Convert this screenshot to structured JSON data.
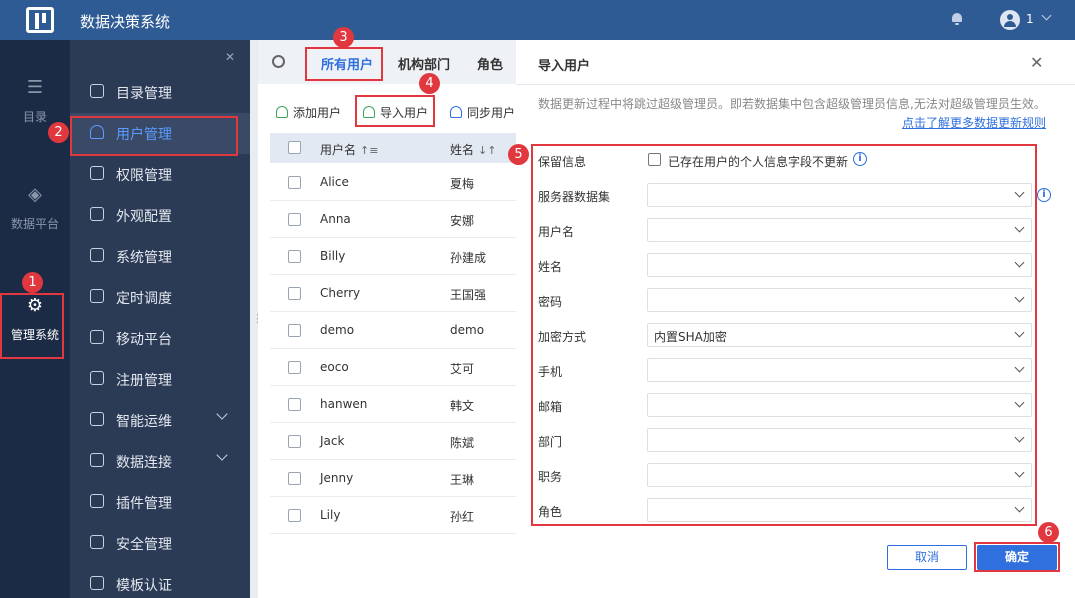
{
  "app": {
    "title": "数据决策系统",
    "user": "1"
  },
  "rail": [
    {
      "label": "目录",
      "icon": "list-icon"
    },
    {
      "label": "数据平台",
      "icon": "cube-icon"
    },
    {
      "label": "管理系统",
      "icon": "gear-icon"
    }
  ],
  "menu": [
    {
      "label": "目录管理",
      "icon": "catalog-icon"
    },
    {
      "label": "用户管理",
      "icon": "user-icon"
    },
    {
      "label": "权限管理",
      "icon": "lock-icon"
    },
    {
      "label": "外观配置",
      "icon": "brush-icon"
    },
    {
      "label": "系统管理",
      "icon": "settings-icon"
    },
    {
      "label": "定时调度",
      "icon": "clock-icon"
    },
    {
      "label": "移动平台",
      "icon": "mobile-icon"
    },
    {
      "label": "注册管理",
      "icon": "register-icon"
    },
    {
      "label": "智能运维",
      "icon": "ops-icon"
    },
    {
      "label": "数据连接",
      "icon": "link-icon"
    },
    {
      "label": "插件管理",
      "icon": "plugin-icon"
    },
    {
      "label": "安全管理",
      "icon": "shield-icon"
    },
    {
      "label": "模板认证",
      "icon": "template-icon"
    }
  ],
  "tabs": [
    "所有用户",
    "机构部门",
    "角色"
  ],
  "toolbar": {
    "add": "添加用户",
    "import": "导入用户",
    "sync": "同步用户"
  },
  "table": {
    "headers": {
      "username": "用户名",
      "name": "姓名"
    },
    "rows": [
      {
        "username": "Alice",
        "name": "夏梅"
      },
      {
        "username": "Anna",
        "name": "安娜"
      },
      {
        "username": "Billy",
        "name": "孙建成"
      },
      {
        "username": "Cherry",
        "name": "王国强"
      },
      {
        "username": "demo",
        "name": "demo"
      },
      {
        "username": "eoco",
        "name": "艾可"
      },
      {
        "username": "hanwen",
        "name": "韩文"
      },
      {
        "username": "Jack",
        "name": "陈斌"
      },
      {
        "username": "Jenny",
        "name": "王琳"
      },
      {
        "username": "Lily",
        "name": "孙红"
      }
    ]
  },
  "dialog": {
    "title": "导入用户",
    "notice": "数据更新过程中将跳过超级管理员。即若数据集中包含超级管理员信息,无法对超级管理员生效。",
    "link": "点击了解更多数据更新规则",
    "keep_label": "保留信息",
    "keep_checkbox": "已存在用户的个人信息字段不更新",
    "fields": [
      {
        "label": "服务器数据集",
        "value": ""
      },
      {
        "label": "用户名",
        "value": ""
      },
      {
        "label": "姓名",
        "value": ""
      },
      {
        "label": "密码",
        "value": ""
      },
      {
        "label": "加密方式",
        "value": "内置SHA加密"
      },
      {
        "label": "手机",
        "value": ""
      },
      {
        "label": "邮箱",
        "value": ""
      },
      {
        "label": "部门",
        "value": ""
      },
      {
        "label": "职务",
        "value": ""
      },
      {
        "label": "角色",
        "value": ""
      }
    ],
    "cancel": "取消",
    "confirm": "确定"
  },
  "badges": [
    "1",
    "2",
    "3",
    "4",
    "5",
    "6"
  ],
  "colors": {
    "header": "#2f5b95",
    "sidebar": "#2b3a55",
    "rail": "#1c2b45",
    "accent": "#2f6fde",
    "highlight": "#e0383e"
  }
}
